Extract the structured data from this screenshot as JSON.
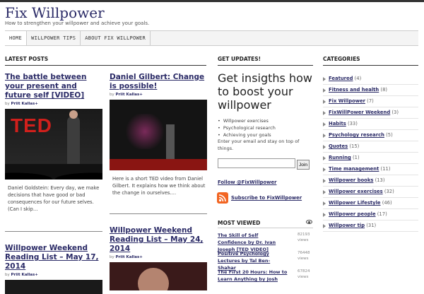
{
  "site": {
    "title": "Fix Willpower",
    "tagline": "How to strengthen your willpower and achieve your goals."
  },
  "nav": [
    {
      "label": "HOME"
    },
    {
      "label": "WILLPOWER TIPS"
    },
    {
      "label": "ABOUT FIX WILLPOWER"
    }
  ],
  "latest": {
    "heading": "LATEST POSTS",
    "posts": [
      {
        "title": "The battle between your present and future self [VIDEO]",
        "by": "by",
        "author": "Priit Kallas+",
        "thumb_text": "TED",
        "excerpt": "Daniel Goldstein: Every day, we make decisions that have good or bad consequences for our future selves. (Can I skip..."
      },
      {
        "title": "Daniel Gilbert: Change is possible!",
        "by": "by",
        "author": "Priit Kallas+",
        "excerpt": "Here is a short TED video from Daniel Gilbert. It explains how we think about the change in ourselves...."
      },
      {
        "title": "Willpower Weekend Reading List – May 17, 2014",
        "by": "by",
        "author": "Priit Kallas+"
      },
      {
        "title": "Willpower Weekend Reading List – May 24, 2014",
        "by": "by",
        "author": "Priit Kallas+"
      }
    ]
  },
  "updates": {
    "heading": "GET UPDATES!",
    "title": "Get insigths how to boost your willpower",
    "items": [
      "Willpower exercises",
      "Psychological research",
      "Achieving your goals"
    ],
    "description": "Enter your email and stay on top of things.",
    "email_placeholder": "",
    "join_label": "Join",
    "follow_label": "Follow @FixWillpower",
    "subscribe_label": "Subscribe to FixWillpower"
  },
  "most_viewed": {
    "heading": "MOST VIEWED",
    "items": [
      {
        "title": "The Skill of Self Confidence by Dr. Ivan Joseph [TED VIDEO]",
        "views": "82193 views"
      },
      {
        "title": "Positive Psychology Lectures by Tal Ben-Shahar",
        "views": "76448 views"
      },
      {
        "title": "The First 20 Hours: How to Learn Anything by Josh",
        "views": "67824 views"
      }
    ]
  },
  "categories": {
    "heading": "CATEGORIES",
    "items": [
      {
        "name": "Featured",
        "count": "(4)"
      },
      {
        "name": "Fitness and health",
        "count": "(8)"
      },
      {
        "name": "Fix Willpower",
        "count": "(7)"
      },
      {
        "name": "FixWillPower Weekend",
        "count": "(3)"
      },
      {
        "name": "Habits",
        "count": "(33)"
      },
      {
        "name": "Psychology research",
        "count": "(5)"
      },
      {
        "name": "Quotes",
        "count": "(15)"
      },
      {
        "name": "Running",
        "count": "(1)"
      },
      {
        "name": "Time management",
        "count": "(11)"
      },
      {
        "name": "Willpower books",
        "count": "(13)"
      },
      {
        "name": "Willpower exercises",
        "count": "(32)"
      },
      {
        "name": "Willpower Lifestyle",
        "count": "(46)"
      },
      {
        "name": "Willpower people",
        "count": "(17)"
      },
      {
        "name": "Willpower tip",
        "count": "(31)"
      }
    ]
  },
  "colors": {
    "link": "#2a2a66",
    "ted_red": "#d0201c",
    "rss": "#f26522"
  }
}
